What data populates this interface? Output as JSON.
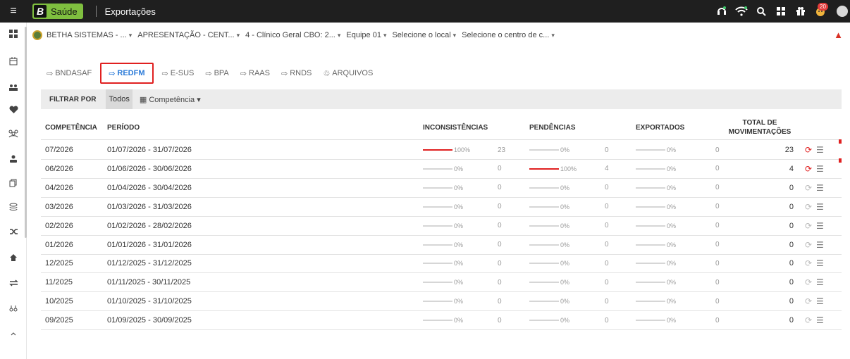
{
  "topbar": {
    "brand_letter": "B",
    "brand_name": "Saúde",
    "app_title": "Exportações",
    "notification_count": "20"
  },
  "context": {
    "items": [
      {
        "label": "BETHA SISTEMAS - ..."
      },
      {
        "label": "APRESENTAÇÃO - CENT..."
      },
      {
        "label": "4 - Clínico Geral CBO: 2..."
      },
      {
        "label": "Equipe 01"
      },
      {
        "label": "Selecione o local"
      },
      {
        "label": "Selecione o centro de c..."
      }
    ]
  },
  "tabs": [
    {
      "label": "BNDASAF",
      "active": false
    },
    {
      "label": "REDFM",
      "active": true
    },
    {
      "label": "E-SUS",
      "active": false
    },
    {
      "label": "BPA",
      "active": false
    },
    {
      "label": "RAAS",
      "active": false
    },
    {
      "label": "RNDS",
      "active": false
    },
    {
      "label": "ARQUIVOS",
      "active": false
    }
  ],
  "filter": {
    "label": "FILTRAR POR",
    "todos": "Todos",
    "competencia": "Competência"
  },
  "table": {
    "headers": {
      "competencia": "COMPETÊNCIA",
      "periodo": "PERÍODO",
      "inconsistencias": "INCONSISTÊNCIAS",
      "pendencias": "PENDÊNCIAS",
      "exportados": "EXPORTADOS",
      "total_line1": "TOTAL DE",
      "total_line2": "MOVIMENTAÇÕES"
    },
    "rows": [
      {
        "competencia": "07/2026",
        "periodo": "01/07/2026 - 31/07/2026",
        "inc_pct": "100%",
        "inc_fill": 1,
        "inc_cnt": "23",
        "pen_pct": "0%",
        "pen_fill": 0,
        "pen_cnt": "0",
        "exp_pct": "0%",
        "exp_fill": 0,
        "exp_cnt": "0",
        "total": "23",
        "active": true
      },
      {
        "competencia": "06/2026",
        "periodo": "01/06/2026 - 30/06/2026",
        "inc_pct": "0%",
        "inc_fill": 0,
        "inc_cnt": "0",
        "pen_pct": "100%",
        "pen_fill": 1,
        "pen_cnt": "4",
        "exp_pct": "0%",
        "exp_fill": 0,
        "exp_cnt": "0",
        "total": "4",
        "active": true
      },
      {
        "competencia": "04/2026",
        "periodo": "01/04/2026 - 30/04/2026",
        "inc_pct": "0%",
        "inc_fill": 0,
        "inc_cnt": "0",
        "pen_pct": "0%",
        "pen_fill": 0,
        "pen_cnt": "0",
        "exp_pct": "0%",
        "exp_fill": 0,
        "exp_cnt": "0",
        "total": "0",
        "active": false
      },
      {
        "competencia": "03/2026",
        "periodo": "01/03/2026 - 31/03/2026",
        "inc_pct": "0%",
        "inc_fill": 0,
        "inc_cnt": "0",
        "pen_pct": "0%",
        "pen_fill": 0,
        "pen_cnt": "0",
        "exp_pct": "0%",
        "exp_fill": 0,
        "exp_cnt": "0",
        "total": "0",
        "active": false
      },
      {
        "competencia": "02/2026",
        "periodo": "01/02/2026 - 28/02/2026",
        "inc_pct": "0%",
        "inc_fill": 0,
        "inc_cnt": "0",
        "pen_pct": "0%",
        "pen_fill": 0,
        "pen_cnt": "0",
        "exp_pct": "0%",
        "exp_fill": 0,
        "exp_cnt": "0",
        "total": "0",
        "active": false
      },
      {
        "competencia": "01/2026",
        "periodo": "01/01/2026 - 31/01/2026",
        "inc_pct": "0%",
        "inc_fill": 0,
        "inc_cnt": "0",
        "pen_pct": "0%",
        "pen_fill": 0,
        "pen_cnt": "0",
        "exp_pct": "0%",
        "exp_fill": 0,
        "exp_cnt": "0",
        "total": "0",
        "active": false
      },
      {
        "competencia": "12/2025",
        "periodo": "01/12/2025 - 31/12/2025",
        "inc_pct": "0%",
        "inc_fill": 0,
        "inc_cnt": "0",
        "pen_pct": "0%",
        "pen_fill": 0,
        "pen_cnt": "0",
        "exp_pct": "0%",
        "exp_fill": 0,
        "exp_cnt": "0",
        "total": "0",
        "active": false
      },
      {
        "competencia": "11/2025",
        "periodo": "01/11/2025 - 30/11/2025",
        "inc_pct": "0%",
        "inc_fill": 0,
        "inc_cnt": "0",
        "pen_pct": "0%",
        "pen_fill": 0,
        "pen_cnt": "0",
        "exp_pct": "0%",
        "exp_fill": 0,
        "exp_cnt": "0",
        "total": "0",
        "active": false
      },
      {
        "competencia": "10/2025",
        "periodo": "01/10/2025 - 31/10/2025",
        "inc_pct": "0%",
        "inc_fill": 0,
        "inc_cnt": "0",
        "pen_pct": "0%",
        "pen_fill": 0,
        "pen_cnt": "0",
        "exp_pct": "0%",
        "exp_fill": 0,
        "exp_cnt": "0",
        "total": "0",
        "active": false
      },
      {
        "competencia": "09/2025",
        "periodo": "01/09/2025 - 30/09/2025",
        "inc_pct": "0%",
        "inc_fill": 0,
        "inc_cnt": "0",
        "pen_pct": "0%",
        "pen_fill": 0,
        "pen_cnt": "0",
        "exp_pct": "0%",
        "exp_fill": 0,
        "exp_cnt": "0",
        "total": "0",
        "active": false
      }
    ]
  },
  "colors": {
    "topbar": "#1f1f1f",
    "brand": "#7fbf3f",
    "active_tab": "#2b7bd8",
    "alert_red": "#e02020"
  }
}
